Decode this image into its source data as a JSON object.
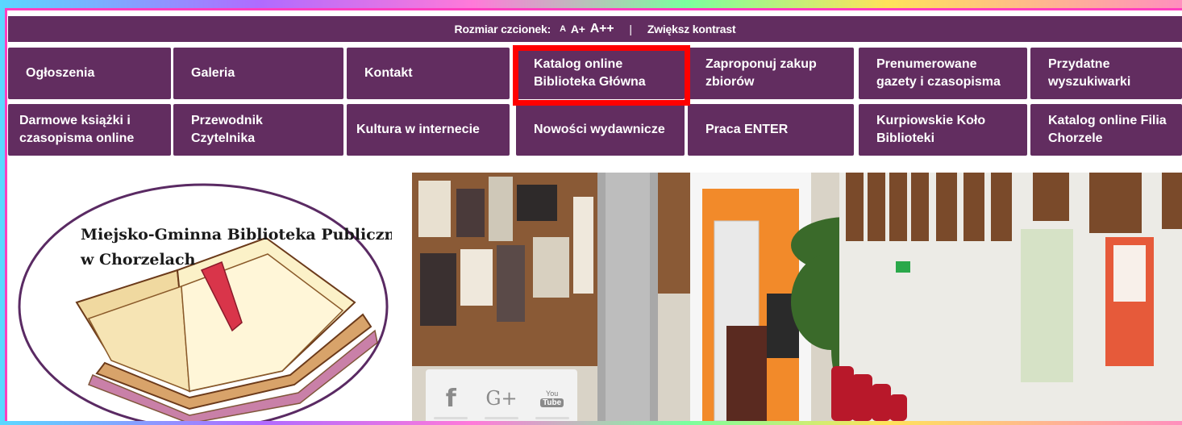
{
  "topbar": {
    "font_size_label": "Rozmiar czcionek:",
    "font_small": "A",
    "font_medium": "A+",
    "font_large": "A++",
    "separator": "|",
    "contrast": "Zwiększ kontrast"
  },
  "nav": {
    "row1": [
      {
        "label": "Ogłoszenia"
      },
      {
        "label": "Galeria"
      },
      {
        "label": "Kontakt"
      },
      {
        "label": "Katalog online Biblioteka Główna"
      },
      {
        "label": "Zaproponuj zakup zbiorów"
      },
      {
        "label": "Prenumerowane gazety i czasopisma"
      },
      {
        "label": "Przydatne wyszukiwarki"
      }
    ],
    "row2": [
      {
        "label": "Darmowe książki i czasopisma online"
      },
      {
        "label": "Przewodnik Czytelnika"
      },
      {
        "label": "Kultura w internecie"
      },
      {
        "label": "Nowości wydawnicze"
      },
      {
        "label": "Praca ENTER"
      },
      {
        "label": "Kurpiowskie Koło Biblioteki"
      },
      {
        "label": "Katalog online Filia Chorzele"
      }
    ]
  },
  "logo": {
    "line1": "Miejsko-Gminna  Biblioteka Publiczna",
    "line2": "w Chorzelach"
  },
  "social": {
    "facebook_glyph": "f",
    "google_glyph": "G+",
    "youtube_you": "You",
    "youtube_tube": "Tube"
  },
  "colors": {
    "nav_bg": "#622d60",
    "highlight": "#ff0000",
    "frame_border": "#ff3fbf"
  }
}
